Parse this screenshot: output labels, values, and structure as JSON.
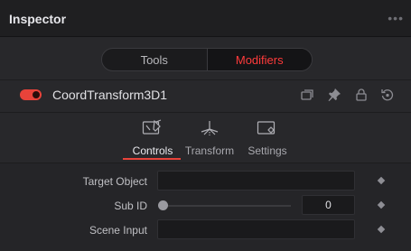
{
  "header": {
    "title": "Inspector",
    "more_label": "•••"
  },
  "segment": {
    "tools_label": "Tools",
    "modifiers_label": "Modifiers",
    "active": "Modifiers"
  },
  "node": {
    "name": "CoordTransform3D1",
    "enabled": true
  },
  "tabs": [
    {
      "label": "Controls",
      "icon": "controls-icon",
      "active": true
    },
    {
      "label": "Transform",
      "icon": "transform-icon",
      "active": false
    },
    {
      "label": "Settings",
      "icon": "settings-icon",
      "active": false
    }
  ],
  "controls": {
    "target_object": {
      "label": "Target Object",
      "value": ""
    },
    "sub_id": {
      "label": "Sub ID",
      "value": "0",
      "slider_fraction": 0
    },
    "scene_input": {
      "label": "Scene Input",
      "value": ""
    }
  },
  "colors": {
    "accent": "#e8433a",
    "active_text": "#ff3b3b",
    "background": "#28282b"
  }
}
